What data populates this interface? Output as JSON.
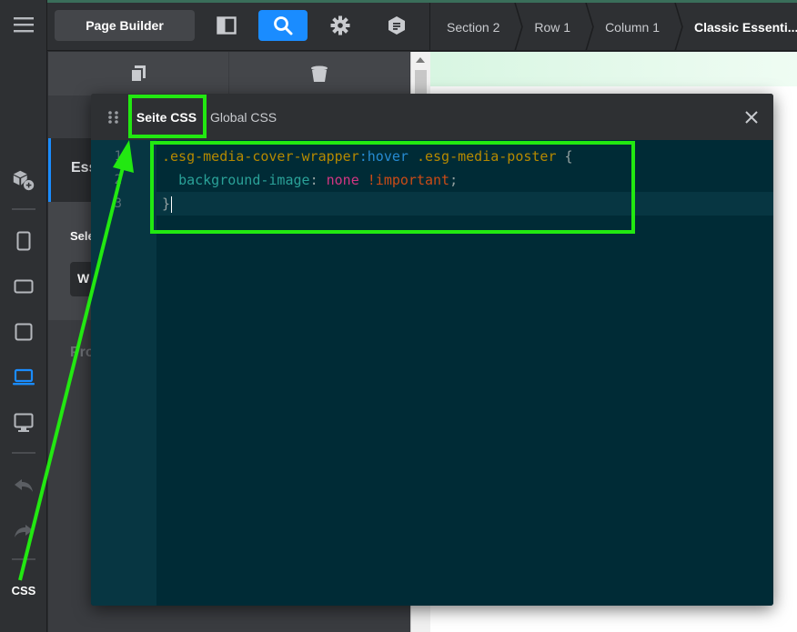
{
  "topbar": {
    "page_builder_label": "Page Builder",
    "breadcrumbs": [
      "Section 2",
      "Row 1",
      "Column 1",
      "Classic Essenti..."
    ]
  },
  "rail": {
    "css_label": "CSS"
  },
  "panel": {
    "heading": "Ess",
    "select_label": "Sele",
    "input_value": "W",
    "footer_label": "Pro"
  },
  "modal": {
    "tabs": [
      {
        "label": "Seite CSS",
        "active": true
      },
      {
        "label": "Global CSS",
        "active": false
      }
    ],
    "line_numbers": [
      "1",
      "2",
      "3"
    ],
    "code": {
      "line1_selector1": ".esg-media-cover-wrapper",
      "line1_pseudo": ":hover",
      "line1_selector2": " .esg-media-poster",
      "line1_brace": " {",
      "line2_indent": "  ",
      "line2_prop": "background-image",
      "line2_colon": ": ",
      "line2_value": "none",
      "line2_important": " !important",
      "line2_semicolon": ";",
      "line3_brace": "}"
    }
  },
  "icons": {
    "rail": [
      "hamburger-menu-icon",
      "add-module-icon",
      "mobile-portrait-icon",
      "mobile-landscape-icon",
      "tablet-icon",
      "laptop-icon",
      "desktop-icon",
      "undo-icon",
      "redo-icon"
    ],
    "topbar": [
      "layout-panel-icon",
      "search-icon",
      "gear-icon",
      "stack-icon"
    ]
  },
  "colors": {
    "accent": "#1a8cff",
    "annotation_green": "#22e811",
    "editor_bg": "#002b36"
  }
}
